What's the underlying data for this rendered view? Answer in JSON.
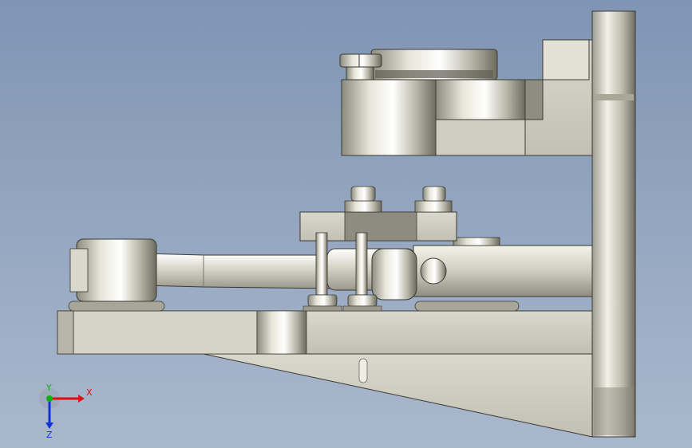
{
  "viewport": {
    "background_top": "#7f95b4",
    "background_bottom": "#aab8cc"
  },
  "triad": {
    "x_label": "X",
    "y_label": "Y",
    "z_label": "Z",
    "x_color": "#e01010",
    "y_color": "#10b010",
    "z_color": "#1030e0"
  }
}
